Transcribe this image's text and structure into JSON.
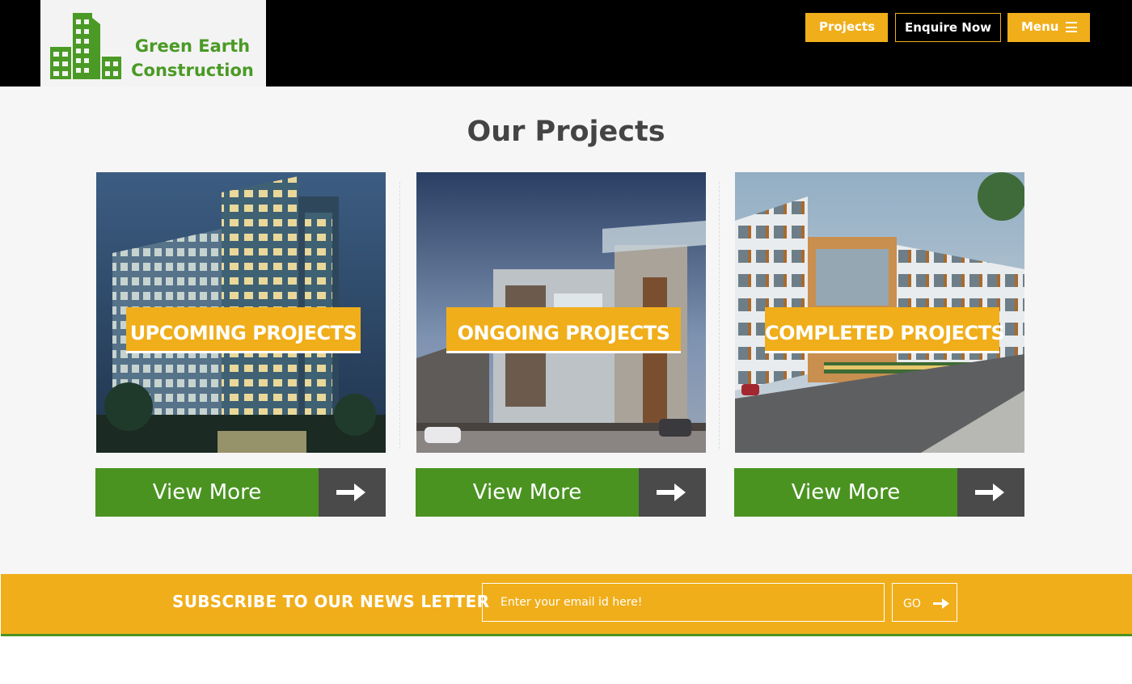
{
  "header": {
    "logo": {
      "line1": "Green Earth",
      "line2": "Construction",
      "color": "#4a9a25"
    },
    "buttons": {
      "projects": "Projects",
      "enquire": "Enquire Now",
      "menu": "Menu"
    }
  },
  "main": {
    "title": "Our Projects",
    "cards": [
      {
        "label": "UPCOMING PROJECTS",
        "button": "View More"
      },
      {
        "label": "ONGOING PROJECTS",
        "button": "View More"
      },
      {
        "label": "COMPLETED PROJECTS",
        "button": "View More"
      }
    ]
  },
  "newsletter": {
    "title": "SUBSCRIBE TO OUR NEWS LETTER",
    "placeholder": "Enter your email id here!",
    "go": "GO"
  },
  "colors": {
    "accent": "#f0ae1a",
    "green": "#4a9321",
    "dark": "#4a4a4a",
    "header_bg": "#000000"
  }
}
